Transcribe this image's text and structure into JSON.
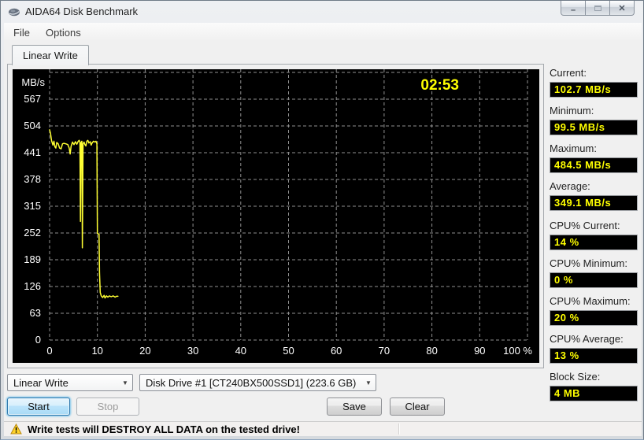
{
  "window": {
    "title": "AIDA64 Disk Benchmark",
    "icons": {
      "app": "aida64-app-icon",
      "minimize": "–",
      "maximize": "□",
      "close": "✕",
      "combo_arrow": "▼",
      "warning": "⚠"
    }
  },
  "menu": {
    "items": [
      "File",
      "Options"
    ]
  },
  "tabs": [
    {
      "label": "Linear Write"
    }
  ],
  "chart_data": {
    "type": "line",
    "title": "",
    "xlabel": "",
    "ylabel": "MB/s",
    "unit_label": "MB/s",
    "timer": "02:53",
    "xlim": [
      0,
      100
    ],
    "ylim": [
      0,
      630
    ],
    "grid": true,
    "grid_color": "#909090",
    "background": "#000000",
    "line_color": "#ffff33",
    "x_ticks": [
      0,
      10,
      20,
      30,
      40,
      50,
      60,
      70,
      80,
      90,
      100
    ],
    "x_tick_labels": [
      "0",
      "10",
      "20",
      "30",
      "40",
      "50",
      "60",
      "70",
      "80",
      "90",
      "100 %"
    ],
    "y_grid_step": 63,
    "y_ticks": [
      567,
      504,
      441,
      378,
      315,
      252,
      189,
      126,
      63,
      0
    ],
    "y_tick_labels": [
      "567",
      "504",
      "441",
      "378",
      "315",
      "252",
      "189",
      "126",
      "63",
      "0"
    ],
    "legend": "none",
    "series": [
      {
        "name": "Linear Write",
        "points": [
          [
            0,
            495
          ],
          [
            0.2,
            486
          ],
          [
            0.4,
            470
          ],
          [
            0.7,
            459
          ],
          [
            0.9,
            468
          ],
          [
            1.1,
            455
          ],
          [
            1.3,
            452
          ],
          [
            1.5,
            465
          ],
          [
            1.8,
            462
          ],
          [
            2.1,
            452
          ],
          [
            2.4,
            450
          ],
          [
            2.7,
            462
          ],
          [
            3.0,
            463
          ],
          [
            3.4,
            462
          ],
          [
            3.8,
            460
          ],
          [
            4.1,
            452
          ],
          [
            4.3,
            438
          ],
          [
            4.5,
            456
          ],
          [
            4.8,
            466
          ],
          [
            5.1,
            460
          ],
          [
            5.4,
            467
          ],
          [
            5.7,
            461
          ],
          [
            6.0,
            468
          ],
          [
            6.2,
            470
          ],
          [
            6.35,
            466
          ],
          [
            6.45,
            279
          ],
          [
            6.55,
            464
          ],
          [
            6.75,
            468
          ],
          [
            6.85,
            217
          ],
          [
            7.0,
            462
          ],
          [
            7.2,
            466
          ],
          [
            7.4,
            460
          ],
          [
            7.6,
            457
          ],
          [
            7.8,
            468
          ],
          [
            8.0,
            470
          ],
          [
            8.2,
            464
          ],
          [
            8.5,
            467
          ],
          [
            8.7,
            459
          ],
          [
            8.9,
            464
          ],
          [
            9.2,
            468
          ],
          [
            9.5,
            466
          ],
          [
            9.7,
            468
          ],
          [
            9.9,
            462
          ],
          [
            10.0,
            251
          ],
          [
            10.35,
            249
          ],
          [
            10.45,
            158
          ],
          [
            10.6,
            112
          ],
          [
            10.8,
            104
          ],
          [
            11.1,
            100
          ],
          [
            11.4,
            105
          ],
          [
            11.6,
            99
          ],
          [
            11.9,
            104
          ],
          [
            12.2,
            101
          ],
          [
            12.5,
            104
          ],
          [
            12.9,
            102
          ],
          [
            13.3,
            104
          ],
          [
            13.7,
            101
          ],
          [
            14.0,
            103
          ],
          [
            14.3,
            103
          ]
        ]
      }
    ]
  },
  "stats": [
    {
      "label": "Current:",
      "value": "102.7 MB/s"
    },
    {
      "label": "Minimum:",
      "value": "99.5 MB/s"
    },
    {
      "label": "Maximum:",
      "value": "484.5 MB/s"
    },
    {
      "label": "Average:",
      "value": "349.1 MB/s"
    },
    {
      "label": "CPU% Current:",
      "value": "14 %"
    },
    {
      "label": "CPU% Minimum:",
      "value": "0 %"
    },
    {
      "label": "CPU% Maximum:",
      "value": "20 %"
    },
    {
      "label": "CPU% Average:",
      "value": "13 %"
    },
    {
      "label": "Block Size:",
      "value": "4 MB"
    }
  ],
  "controls": {
    "test_select": "Linear Write",
    "drive_select": "Disk Drive #1  [CT240BX500SSD1]  (223.6 GB)",
    "start": "Start",
    "stop": "Stop",
    "save": "Save",
    "clear": "Clear"
  },
  "statusbar": {
    "warning": "Write tests will DESTROY ALL DATA on the tested drive!"
  }
}
